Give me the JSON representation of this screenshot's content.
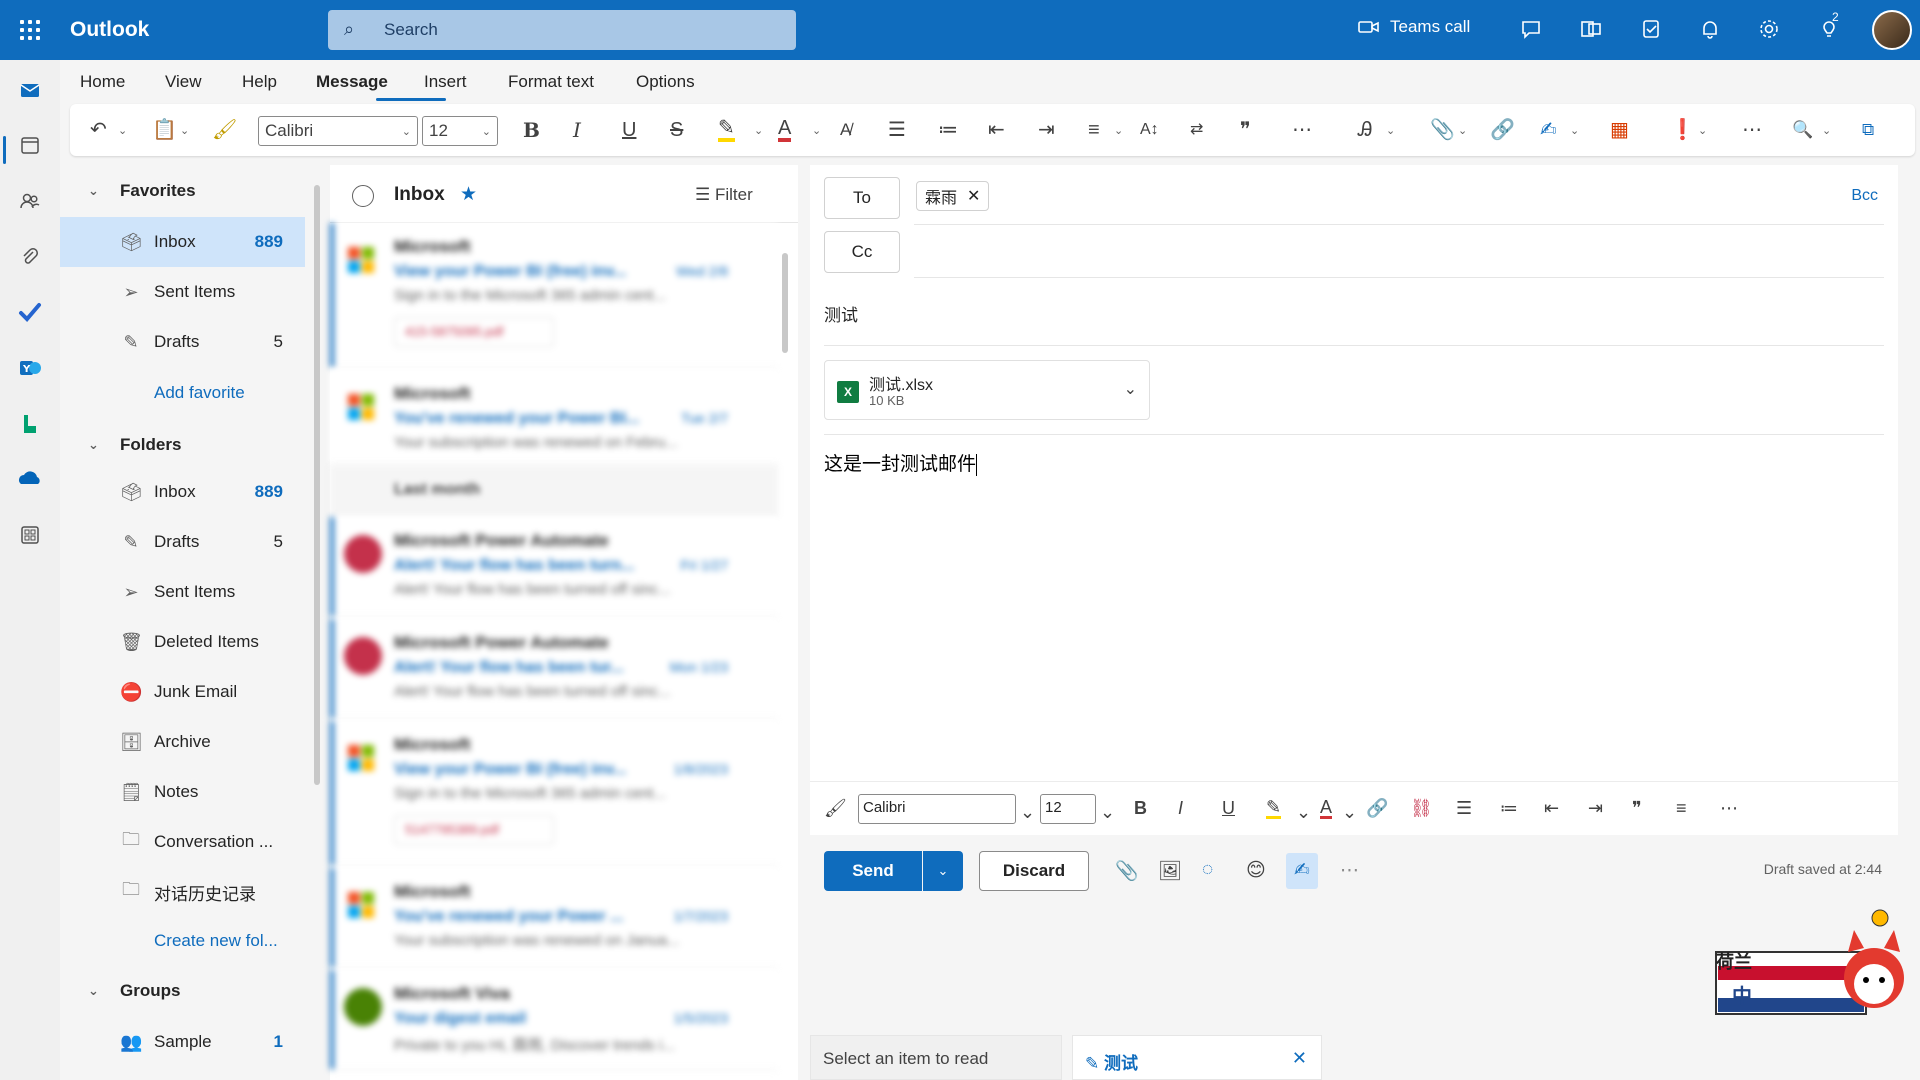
{
  "header": {
    "app_title": "Outlook",
    "search_placeholder": "Search",
    "teams_call_label": "Teams call",
    "tips_badge_count": "2"
  },
  "ribbon": {
    "tabs": [
      "Home",
      "View",
      "Help",
      "Message",
      "Insert",
      "Format text",
      "Options"
    ],
    "active_tab": "Message",
    "font_name": "Calibri",
    "font_size": "12"
  },
  "folders": {
    "favorites_header": "Favorites",
    "favorites": [
      {
        "label": "Inbox",
        "count": "889",
        "icon": "inbox-icon"
      },
      {
        "label": "Sent Items",
        "count": "",
        "icon": "send-icon"
      },
      {
        "label": "Drafts",
        "count": "5",
        "icon": "pencil-icon"
      }
    ],
    "add_favorite": "Add favorite",
    "folders_header": "Folders",
    "folder_items": [
      {
        "label": "Inbox",
        "count": "889"
      },
      {
        "label": "Drafts",
        "count": "5"
      },
      {
        "label": "Sent Items",
        "count": ""
      },
      {
        "label": "Deleted Items",
        "count": ""
      },
      {
        "label": "Junk Email",
        "count": ""
      },
      {
        "label": "Archive",
        "count": ""
      },
      {
        "label": "Notes",
        "count": ""
      },
      {
        "label": "Conversation ...",
        "count": ""
      },
      {
        "label": "对话历史记录",
        "count": ""
      }
    ],
    "create_new_folder": "Create new fol...",
    "groups_header": "Groups",
    "groups": [
      {
        "label": "Sample",
        "count": "1"
      }
    ]
  },
  "message_list": {
    "title": "Inbox",
    "filter_label": "Filter",
    "separator": "Last month",
    "messages": [
      {
        "sender": "Microsoft",
        "subject": "View your Power BI (free) inv...",
        "date": "Wed 2/8",
        "preview": "Sign in to the Microsoft 365 admin cent...",
        "attachment": "415-5875095.pdf"
      },
      {
        "sender": "Microsoft",
        "subject": "You've renewed your Power BI...",
        "date": "Tue 2/7",
        "preview": "Your subscription was renewed on Febru...",
        "attachment": ""
      },
      {
        "sender": "Microsoft Power Automate",
        "subject": "Alert! Your flow has been turn...",
        "date": "Fri 1/27",
        "preview": "Alert! Your flow has been turned off sinc...",
        "attachment": ""
      },
      {
        "sender": "Microsoft Power Automate",
        "subject": "Alert! Your flow has been tur...",
        "date": "Mon 1/23",
        "preview": "Alert! Your flow has been turned off sinc...",
        "attachment": ""
      },
      {
        "sender": "Microsoft",
        "subject": "View your Power BI (free) inv...",
        "date": "1/8/2023",
        "preview": "Sign in to the Microsoft 365 admin cent...",
        "attachment": "5147795389.pdf"
      },
      {
        "sender": "Microsoft",
        "subject": "You've renewed your Power ...",
        "date": "1/7/2023",
        "preview": "Your subscription was renewed on Janua...",
        "attachment": ""
      },
      {
        "sender": "Microsoft Viva",
        "subject": "Your digest email",
        "date": "1/5/2023",
        "preview": "Private to you Hi, 霖雨, Discover trends i...",
        "attachment": ""
      }
    ]
  },
  "compose": {
    "to_label": "To",
    "cc_label": "Cc",
    "bcc_label": "Bcc",
    "recipient": "霖雨",
    "subject": "测试",
    "attachment_name": "测试.xlsx",
    "attachment_size": "10 KB",
    "body": "这是一封测试邮件",
    "font_name": "Calibri",
    "font_size": "12",
    "send_label": "Send",
    "discard_label": "Discard",
    "draft_status": "Draft saved at 2:44"
  },
  "bottom_tabs": {
    "read_label": "Select an item to read",
    "draft_label": "测试"
  },
  "mascot": {
    "top_text": "荷兰",
    "bottom_text": "中"
  },
  "colors": {
    "brand": "#0f6cbd",
    "selected_bg": "#cfe4fa",
    "excel_green": "#107c41"
  }
}
